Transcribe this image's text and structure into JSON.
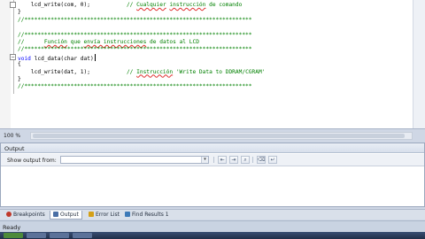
{
  "editor": {
    "lines": [
      {
        "code": "    lcd_write(com, 0);           ",
        "comment": "// ",
        "comment_sq": "Cualquier",
        "comment_rest": " ",
        "comment_sq2": "instrucción",
        "comment_tail": " de comando"
      },
      {
        "code": "}",
        "comment": "",
        "comment_sq": "",
        "comment_rest": "",
        "comment_sq2": "",
        "comment_tail": ""
      },
      {
        "code": "",
        "comment": "//*********************************************************************",
        "comment_sq": "",
        "comment_rest": "",
        "comment_sq2": "",
        "comment_tail": ""
      },
      {
        "code": "",
        "comment": "",
        "comment_sq": "",
        "comment_rest": "",
        "comment_sq2": "",
        "comment_tail": ""
      },
      {
        "code": "",
        "comment": "//*********************************************************************",
        "comment_sq": "",
        "comment_rest": "",
        "comment_sq2": "",
        "comment_tail": ""
      },
      {
        "code": "",
        "comment": "//      ",
        "comment_sq": "Función",
        "comment_rest": " que ",
        "comment_sq2": "envía instrucciones",
        "comment_tail": " de datos al LCD"
      },
      {
        "code": "",
        "comment": "//*********************************************************************",
        "comment_sq": "",
        "comment_rest": "",
        "comment_sq2": "",
        "comment_tail": ""
      },
      {
        "code": "void lcd_data(char dat)",
        "comment": "",
        "comment_sq": "",
        "comment_rest": "",
        "comment_sq2": "",
        "comment_tail": ""
      },
      {
        "code": "{",
        "comment": "",
        "comment_sq": "",
        "comment_rest": "",
        "comment_sq2": "",
        "comment_tail": ""
      },
      {
        "code": "    lcd_write(dat, 1);           ",
        "comment": "// ",
        "comment_sq": "Instrucción",
        "comment_rest": " 'Write Data to DDRAM/CGRAM'",
        "comment_sq2": "",
        "comment_tail": ""
      },
      {
        "code": "}",
        "comment": "",
        "comment_sq": "",
        "comment_rest": "",
        "comment_sq2": "",
        "comment_tail": ""
      },
      {
        "code": "",
        "comment": "//*********************************************************************",
        "comment_sq": "",
        "comment_rest": "",
        "comment_sq2": "",
        "comment_tail": ""
      }
    ],
    "zoom": "100 %"
  },
  "output": {
    "title": "Output",
    "show_from_label": "Show output from:",
    "show_from_value": ""
  },
  "tabs": [
    {
      "label": "Breakpoints",
      "icon": "breakpoints-icon",
      "color": "#c0392b"
    },
    {
      "label": "Output",
      "icon": "output-icon",
      "color": "#4a6fa5"
    },
    {
      "label": "Error List",
      "icon": "error-list-icon",
      "color": "#d4a017"
    },
    {
      "label": "Find Results 1",
      "icon": "find-results-icon",
      "color": "#3d7ab8"
    }
  ],
  "status": {
    "text": "Ready"
  }
}
